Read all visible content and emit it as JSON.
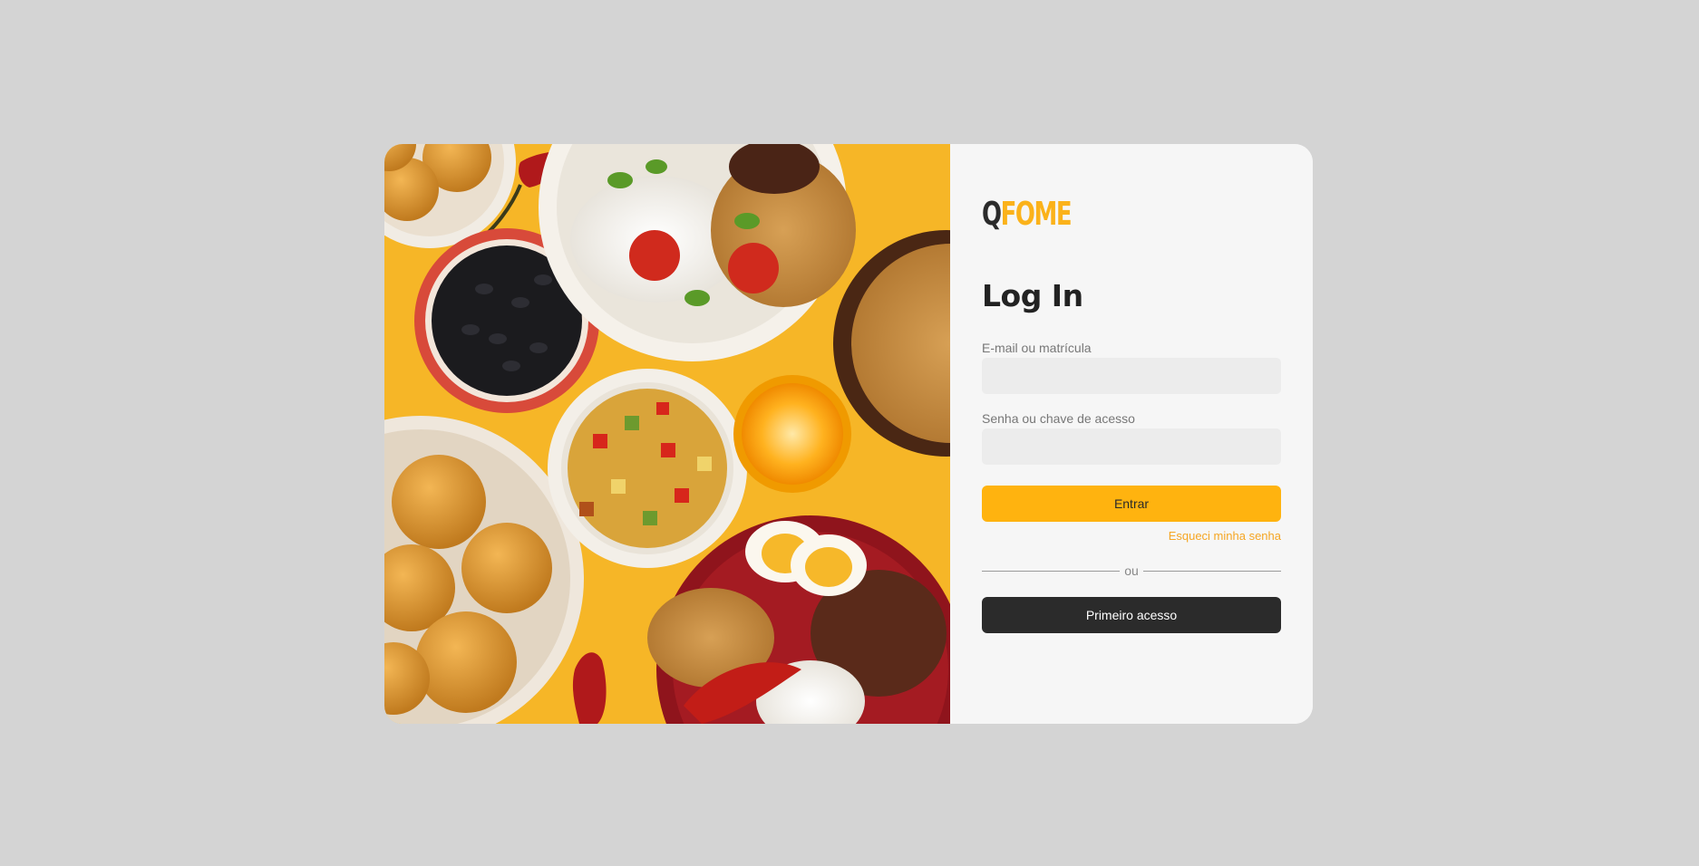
{
  "brand": {
    "logo_q": "Q",
    "logo_rest": "FOME",
    "accent_color": "#ffb30f",
    "dark_color": "#2b2b2b"
  },
  "hero": {
    "image": "food-spread-photo"
  },
  "login": {
    "title": "Log In",
    "email_label": "E-mail ou matrícula",
    "email_value": "",
    "password_label": "Senha ou chave de acesso",
    "password_value": "",
    "submit_label": "Entrar",
    "forgot_label": "Esqueci minha senha",
    "divider_label": "ou",
    "first_access_label": "Primeiro acesso"
  }
}
